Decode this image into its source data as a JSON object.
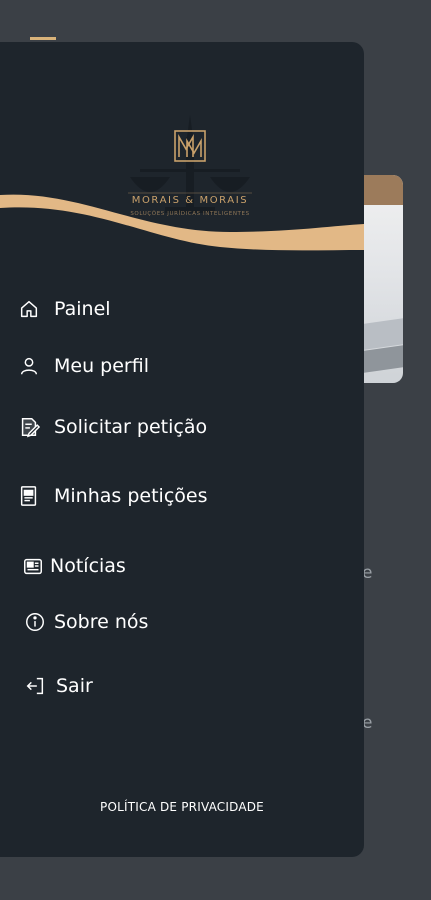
{
  "brand": {
    "name": "MORAIS & MORAIS",
    "tagline": "SOLUÇÕES JURÍDICAS INTELIGENTES",
    "accent_color": "#d9b37a"
  },
  "menu": {
    "items": [
      {
        "label": "Painel",
        "icon": "home-icon"
      },
      {
        "label": "Meu perfil",
        "icon": "user-icon"
      },
      {
        "label": "Solicitar petição",
        "icon": "document-edit-icon"
      },
      {
        "label": "Minhas petições",
        "icon": "document-list-icon"
      },
      {
        "label": "Notícias",
        "icon": "newspaper-icon"
      },
      {
        "label": "Sobre nós",
        "icon": "info-icon"
      },
      {
        "label": "Sair",
        "icon": "logout-icon"
      }
    ]
  },
  "footer": {
    "privacy_label": "POLÍTICA DE PRIVACIDADE"
  },
  "background": {
    "peek_letters": [
      "e",
      "e"
    ]
  }
}
